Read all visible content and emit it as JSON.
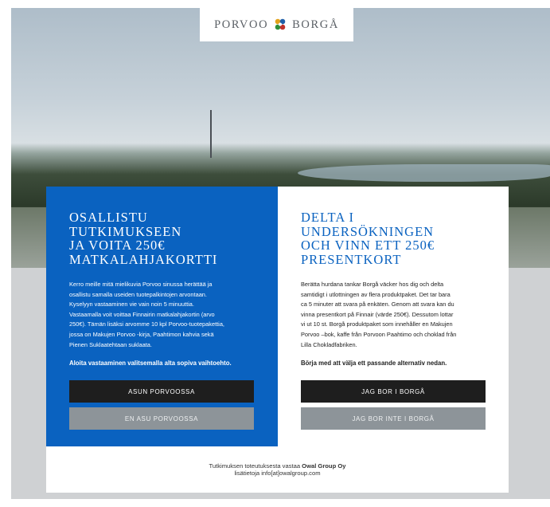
{
  "logo": {
    "left_text": "PORVOO",
    "right_text": "BORGÅ"
  },
  "finnish": {
    "heading_lines": [
      "OSALLISTU TUTKIMUKSEEN",
      "JA VOITA 250€",
      "MATKALAHJAKORTTI"
    ],
    "body_lines": [
      "Kerro meille mitä mielikuvia Porvoo sinussa herättää ja",
      "osallistu samalla useiden tuotepalkintojen arvontaan.",
      "Kyselyyn vastaaminen vie vain noin 5 minuuttia.",
      "Vastaamalla voit voittaa Finnairin matkalahjakortin (arvo",
      "250€). Tämän lisäksi arvomme 10 kpl Porvoo-tuotepakettia,",
      "jossa on Makujen Porvoo -kirja, Paahtimon kahvia sekä",
      "Pienen Suklaatehtaan suklaata."
    ],
    "cta": "Aloita vastaaminen valitsemalla alta sopiva vaihtoehto.",
    "button_primary": "ASUN PORVOOSSA",
    "button_secondary": "EN ASU PORVOOSSA"
  },
  "swedish": {
    "heading_lines": [
      "DELTA I UNDERSÖKNINGEN",
      "OCH VINN ETT 250€",
      "PRESENTKORT"
    ],
    "body_lines": [
      "Berätta hurdana tankar Borgå väcker hos dig och delta",
      "samtidigt i utlottningen av flera produktpaket. Det tar bara",
      "ca 5 minuter att svara på enkäten. Genom att svara kan du",
      "vinna presentkort på Finnair (värde 250€). Dessutom lottar",
      "vi ut 10 st. Borgå produktpaket som innehåller en Makujen",
      "Porvoo –bok, kaffe från Porvoon Paahtimo och choklad från",
      "Lilla Chokladfabriken."
    ],
    "cta": "Börja med att välja ett passande alternativ nedan.",
    "button_primary": "JAG BOR I BORGÅ",
    "button_secondary": "JAG BOR INTE I BORGÅ"
  },
  "footer": {
    "line1_prefix": "Tutkimuksen toteutuksesta vastaa ",
    "line1_company": "Owal Group Oy",
    "line2": "lisätietoja info[at]owalgroup.com"
  },
  "colors": {
    "brand_blue": "#0a62c0",
    "button_dark": "#1e1e1e",
    "button_grey": "#8d9499"
  },
  "icons": {
    "logo_mark": "porvoo-flower-logo-icon"
  }
}
